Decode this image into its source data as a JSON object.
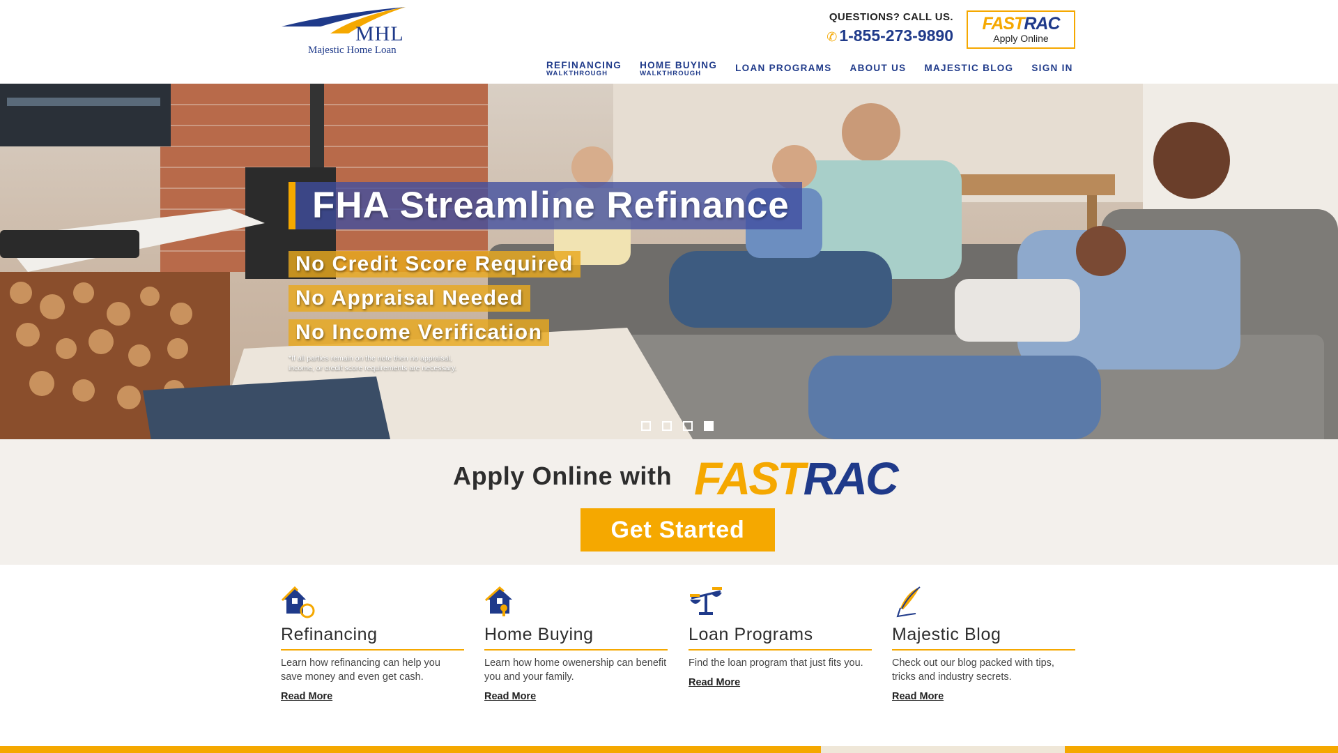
{
  "header": {
    "logo_initials": "MHL",
    "logo_name": "Majestic Home Loan",
    "questions_label": "QUESTIONS? CALL US.",
    "phone": "1-855-273-9890",
    "fastrac_fast": "FAST",
    "fastrac_rac": "RAC",
    "fastrac_label": "Apply Online"
  },
  "nav": {
    "refinancing": "REFINANCING",
    "refinancing_sub": "WALKTHROUGH",
    "home_buying": "HOME BUYING",
    "home_buying_sub": "WALKTHROUGH",
    "loan_programs": "LOAN PROGRAMS",
    "about_us": "ABOUT US",
    "majestic_blog": "MAJESTIC BLOG",
    "sign_in": "SIGN IN"
  },
  "hero": {
    "title": "FHA Streamline Refinance",
    "bullets": [
      "No Credit Score Required",
      "No Appraisal Needed",
      "No Income Verification"
    ],
    "disclaimer": "*If all parties remain on the note then no appraisal, income, or credit score requirements are necessary.",
    "active_slide": 4,
    "slide_count": 4
  },
  "apply": {
    "text": "Apply Online with",
    "logo_fast": "FAST",
    "logo_rac": "RAC",
    "button": "Get Started"
  },
  "features": [
    {
      "icon": "house-refinance-icon",
      "title": "Refinancing",
      "desc": "Learn how refinancing can help you save money and even get cash.",
      "link": "Read More"
    },
    {
      "icon": "house-key-icon",
      "title": "Home Buying",
      "desc": "Learn how home owenership can benefit you and your family.",
      "link": "Read More"
    },
    {
      "icon": "scale-icon",
      "title": "Loan Programs",
      "desc": "Find the loan program that just fits you.",
      "link": "Read More"
    },
    {
      "icon": "quill-icon",
      "title": "Majestic Blog",
      "desc": "Check out our blog packed with tips, tricks and industry secrets.",
      "link": "Read More"
    }
  ],
  "colors": {
    "brand_blue": "#1f3a8a",
    "accent_gold": "#f5a800"
  }
}
